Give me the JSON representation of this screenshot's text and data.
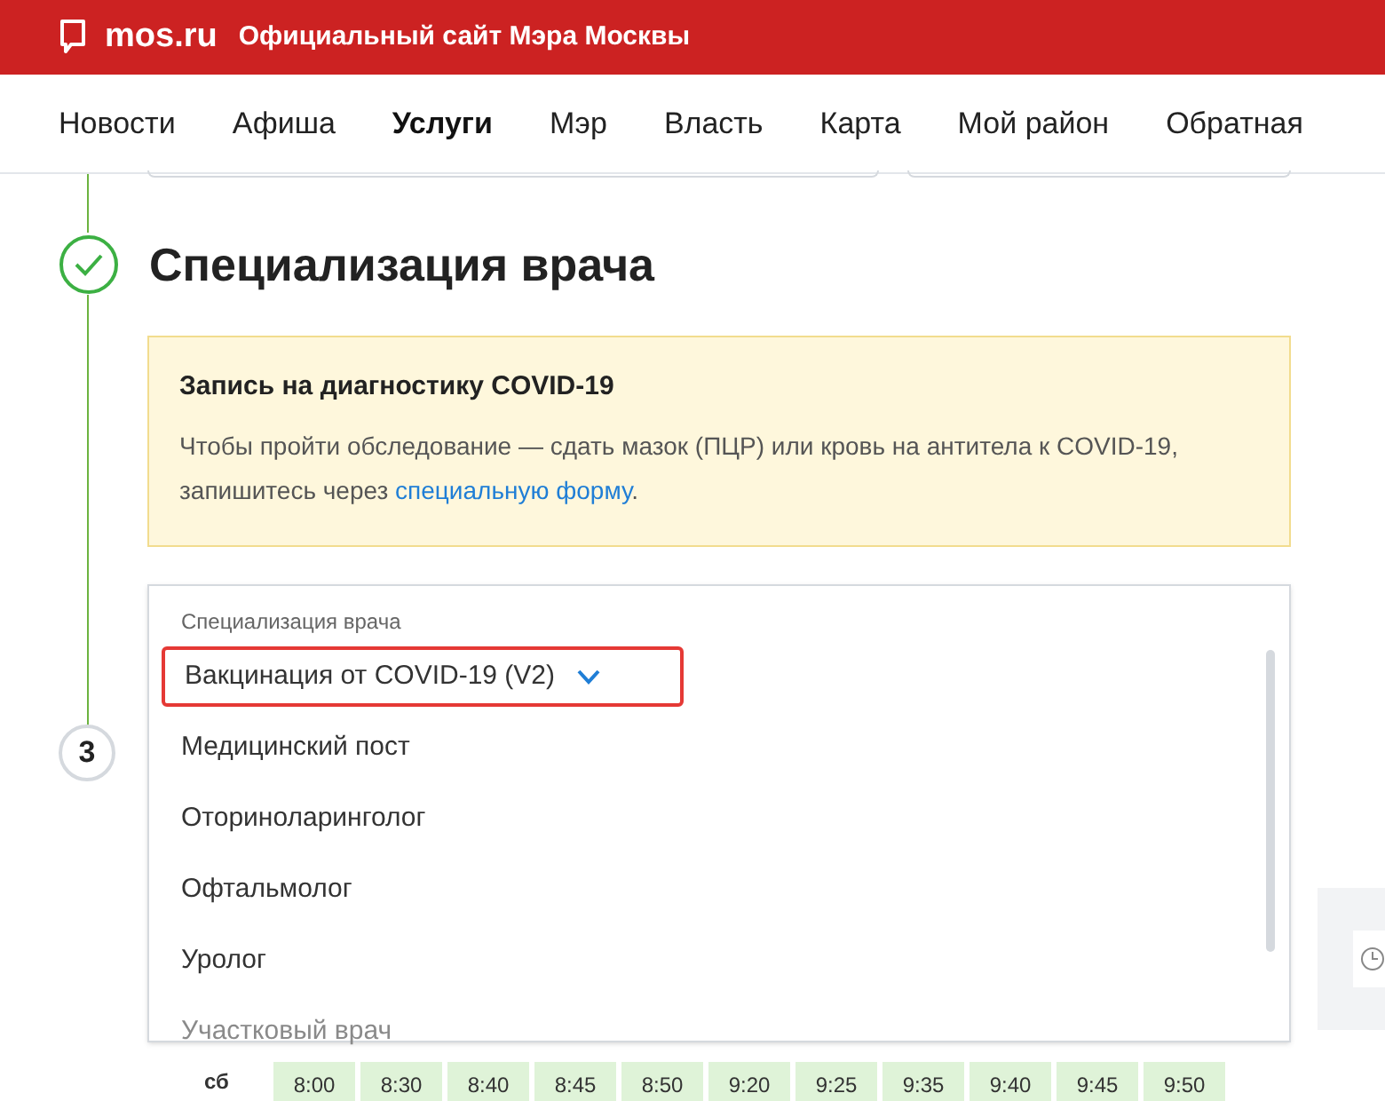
{
  "header": {
    "logo": "mos.ru",
    "title": "Официальный сайт Мэра Москвы"
  },
  "nav": [
    {
      "label": "Новости",
      "selected": false
    },
    {
      "label": "Афиша",
      "selected": false
    },
    {
      "label": "Услуги",
      "selected": true
    },
    {
      "label": "Мэр",
      "selected": false
    },
    {
      "label": "Власть",
      "selected": false
    },
    {
      "label": "Карта",
      "selected": false
    },
    {
      "label": "Мой район",
      "selected": false
    },
    {
      "label": "Обратная",
      "selected": false
    }
  ],
  "step": {
    "title": "Специализация врача",
    "done": true
  },
  "notice": {
    "title": "Запись на диагностику COVID-19",
    "text_before": "Чтобы пройти обследование — сдать мазок (ПЦР) или кровь на антитела к COVID-19, запишитесь через ",
    "link": "специальную форму",
    "text_after": "."
  },
  "dropdown": {
    "label": "Специализация врача",
    "options": [
      {
        "label": "Вакцинация от COVID-19 (V2)",
        "selected": true,
        "faded": false
      },
      {
        "label": "Медицинский пост",
        "selected": false,
        "faded": false
      },
      {
        "label": "Оториноларинголог",
        "selected": false,
        "faded": false
      },
      {
        "label": "Офтальмолог",
        "selected": false,
        "faded": false
      },
      {
        "label": "Уролог",
        "selected": false,
        "faded": false
      },
      {
        "label": "Участковый врач",
        "selected": false,
        "faded": true
      }
    ]
  },
  "next_step": {
    "number": "3"
  },
  "schedule": {
    "day": "сб",
    "slots": [
      "8:00",
      "8:30",
      "8:40",
      "8:45",
      "8:50",
      "9:20",
      "9:25",
      "9:35",
      "9:40",
      "9:45",
      "9:50"
    ]
  }
}
